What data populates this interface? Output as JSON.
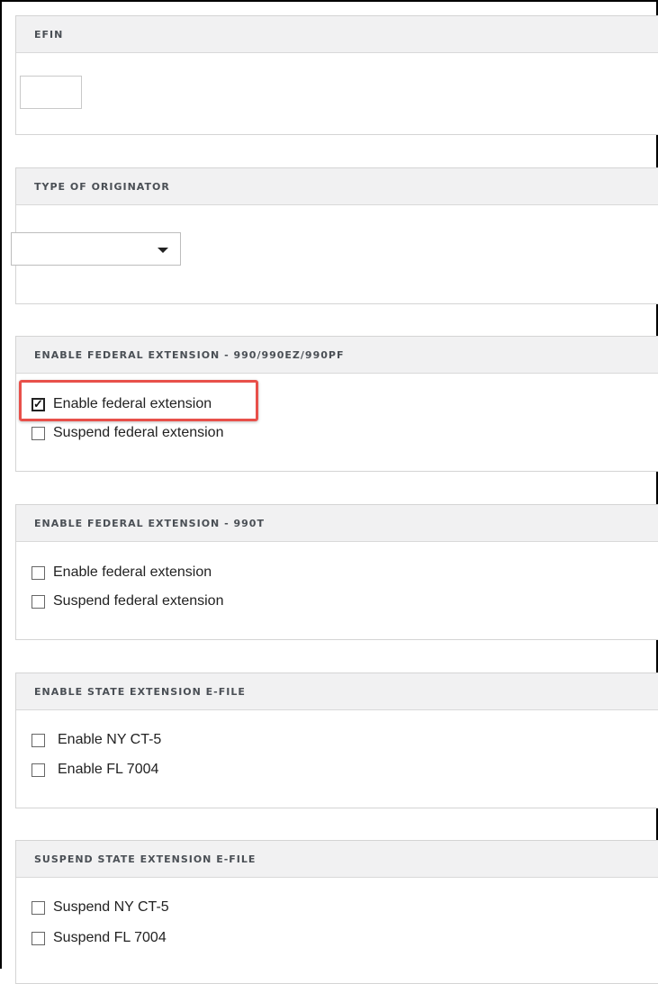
{
  "sections": {
    "efin": {
      "title": "EFIN",
      "value": ""
    },
    "originator": {
      "title": "TYPE OF ORIGINATOR",
      "selected": ""
    },
    "fed990": {
      "title": "ENABLE FEDERAL EXTENSION - 990/990EZ/990PF",
      "enable_label": "Enable federal extension",
      "enable_checked": true,
      "suspend_label": "Suspend federal extension",
      "suspend_checked": false
    },
    "fed990t": {
      "title": "ENABLE FEDERAL EXTENSION - 990T",
      "enable_label": "Enable federal extension",
      "enable_checked": false,
      "suspend_label": "Suspend federal extension",
      "suspend_checked": false
    },
    "state_enable": {
      "title": "ENABLE STATE EXTENSION E-FILE",
      "ny_label": "Enable NY CT-5",
      "ny_checked": false,
      "fl_label": "Enable FL 7004",
      "fl_checked": false
    },
    "state_suspend": {
      "title": "SUSPEND STATE EXTENSION E-FILE",
      "ny_label": "Suspend NY CT-5",
      "ny_checked": false,
      "fl_label": "Suspend FL 7004",
      "fl_checked": false
    }
  },
  "icons": {
    "checkmark": "check-icon",
    "dropdown": "caret-down-icon"
  },
  "colors": {
    "highlight": "#e8504a",
    "header_bg": "#f1f1f2"
  }
}
